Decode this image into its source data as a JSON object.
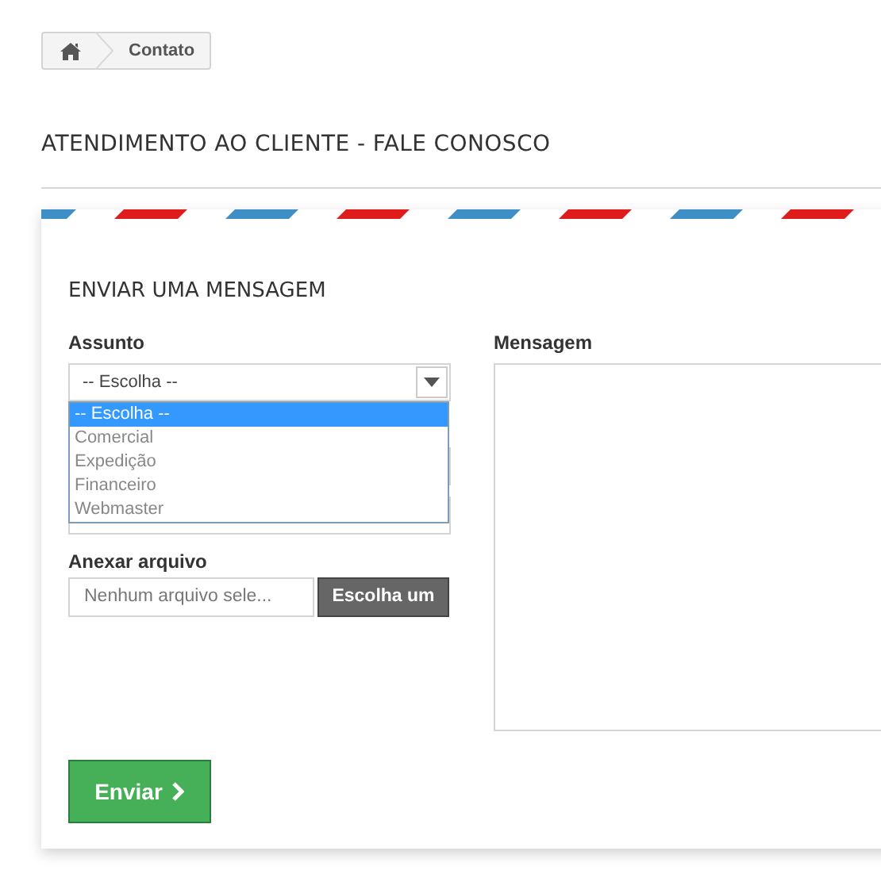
{
  "breadcrumb": {
    "current": "Contato"
  },
  "page_title": "ATENDIMENTO AO CLIENTE - FALE CONOSCO",
  "form": {
    "title": "ENVIAR UMA MENSAGEM",
    "subject": {
      "label": "Assunto",
      "value": "-- Escolha --",
      "expanded": true,
      "options": [
        {
          "label": "-- Escolha --",
          "selected": true
        },
        {
          "label": "Comercial",
          "selected": false
        },
        {
          "label": "Expedição",
          "selected": false
        },
        {
          "label": "Financeiro",
          "selected": false
        },
        {
          "label": "Webmaster",
          "selected": false
        }
      ]
    },
    "attachment": {
      "label": "Anexar arquivo",
      "file_name": "Nenhum arquivo sele...",
      "button": "Escolha um"
    },
    "message": {
      "label": "Mensagem"
    },
    "submit": "Enviar"
  }
}
